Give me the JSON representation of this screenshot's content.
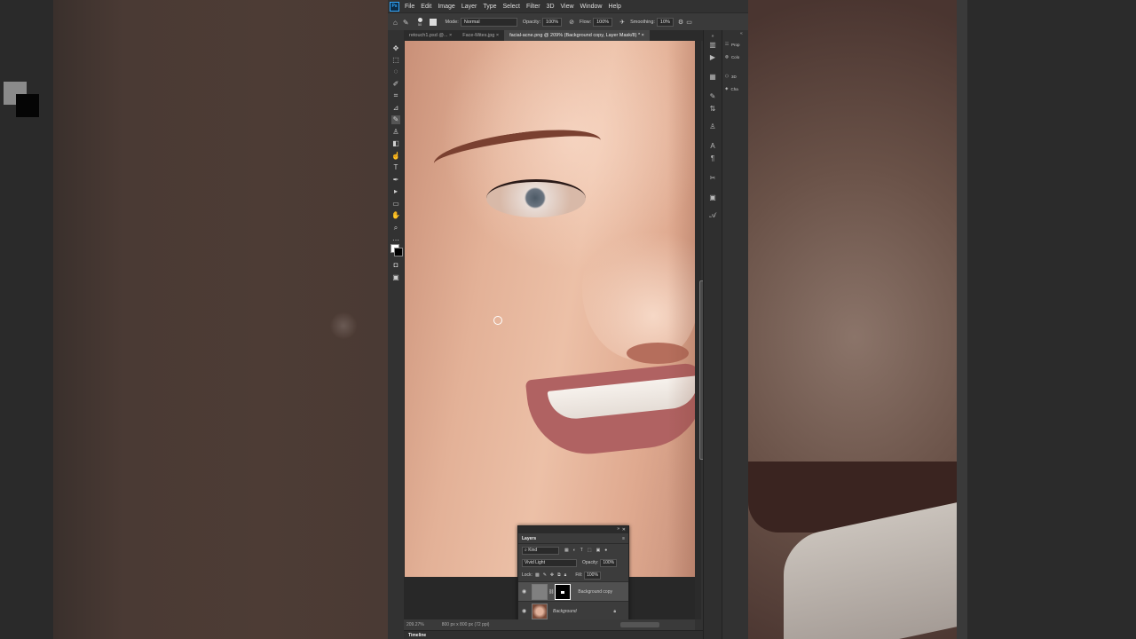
{
  "menu": {
    "logo": "Ps",
    "items": [
      "File",
      "Edit",
      "Image",
      "Layer",
      "Type",
      "Select",
      "Filter",
      "3D",
      "View",
      "Window",
      "Help"
    ]
  },
  "options": {
    "brush_size": "50",
    "mode_label": "Mode:",
    "mode_value": "Normal",
    "opacity_label": "Opacity:",
    "opacity_value": "100%",
    "flow_label": "Flow:",
    "flow_value": "100%",
    "smoothing_label": "Smoothing:",
    "smoothing_value": "10%"
  },
  "tabs": [
    {
      "label": "retouch1.psd @...",
      "active": false
    },
    {
      "label": "Face-Mites.jpg",
      "active": false
    },
    {
      "label": "facial-acne.png @ 209% (Background copy, Layer Mask/8) *",
      "active": true
    }
  ],
  "status": {
    "zoom": "209.27%",
    "doc_info": "800 px x 800 px (72 ppi)"
  },
  "timeline_label": "Timeline",
  "right_panel": {
    "items": [
      "Prop",
      "Colo",
      "3D",
      "Cha"
    ]
  },
  "layers_panel": {
    "title": "Layers",
    "filter_label": "Kind",
    "blend_mode": "Vivid Light",
    "opacity_label": "Opacity:",
    "opacity_value": "100%",
    "lock_label": "Lock:",
    "fill_label": "Fill:",
    "fill_value": "100%",
    "layers": [
      {
        "name": "Background copy",
        "selected": true
      },
      {
        "name": "Background",
        "selected": false,
        "locked": true
      }
    ]
  },
  "colors": {
    "ps_accent": "#31a8ff",
    "panel_bg": "#323232"
  }
}
